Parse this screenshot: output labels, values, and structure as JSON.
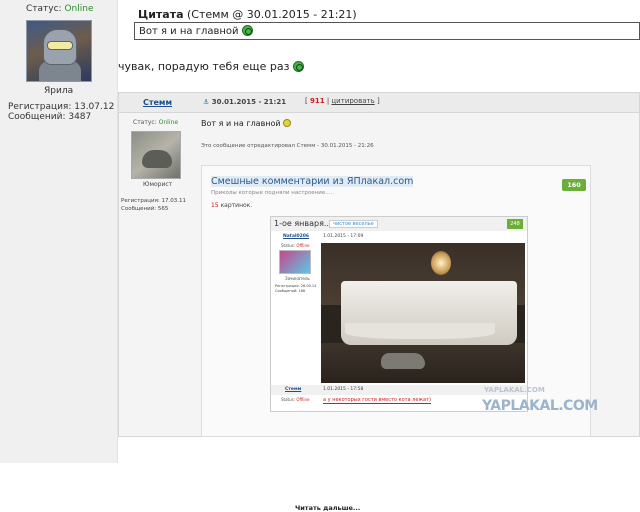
{
  "left": {
    "status_label": "Статус:",
    "status_value": "Online",
    "nick": "Ярила",
    "reg_label": "Регистрация: 13.07.12",
    "posts_label": "Сообщений: 3487"
  },
  "quote": {
    "title": "Цитата",
    "meta": "(Стемм @ 30.01.2015 - 21:21)",
    "text": "Вот я и на главной"
  },
  "post": {
    "text": "чувак, порадую тебя еще раз"
  },
  "inner": {
    "author": "Стемм",
    "date": "30.01.2015 - 21:21",
    "rating_open": "[",
    "rating_value": "911",
    "rating_sep": "|",
    "rating_cite": "цитировать",
    "rating_close": "]",
    "status_label": "Статус:",
    "status_value": "Online",
    "rank": "Юморист",
    "reg": "Регистрация: 17.03.11",
    "posts": "Сообщений: 565",
    "text": "Вот я и на главной",
    "edit_note": "Это сообщение отредактировал Стемм - 30.01.2015 - 21:26",
    "embed": {
      "title": "Смешные комментарии из ЯПлакал.com",
      "subtitle": "Приколы которые подняли настроение.....",
      "count_num": "15",
      "count_text": "картинок.",
      "badge": "160",
      "nested": {
        "title": "1-ое января...",
        "tag": "чистое веселье",
        "badge": "248",
        "user": "Natal0206",
        "date": "1.01.2015 - 17:09",
        "status_label": "Status:",
        "status_value": "Offline",
        "rank": "Зачинатель",
        "reg": "Регистрация: 26.09.14",
        "posts": "Сообщений: 166",
        "foot_user": "Стемм",
        "foot_date": "1.01.2015 - 17:58",
        "foot_status_label": "Status:",
        "foot_status_value": "Offline",
        "foot_text": "а у некоторых гости вместо кота лежат)"
      },
      "readmore": "Читать дальше..."
    }
  },
  "watermark": {
    "main": "YAPLAKAL.COM",
    "small": "YAPLAKAL.COM"
  }
}
